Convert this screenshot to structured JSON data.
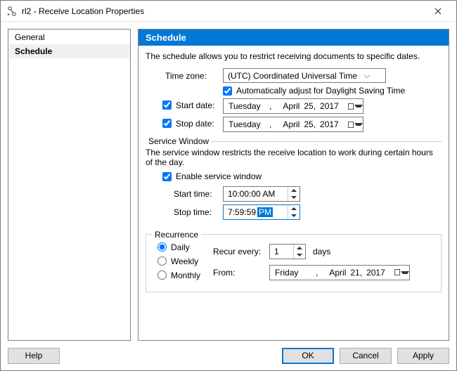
{
  "window": {
    "title": "rl2 - Receive Location Properties"
  },
  "sidebar": {
    "items": [
      {
        "label": "General"
      },
      {
        "label": "Schedule"
      }
    ],
    "selected_index": 1
  },
  "panel": {
    "title": "Schedule",
    "description": "The schedule allows you to restrict receiving documents to specific dates.",
    "timezone": {
      "label": "Time zone:",
      "value": "(UTC) Coordinated Universal Time",
      "auto_dst_label": "Automatically adjust for Daylight Saving Time",
      "auto_dst_checked": true
    },
    "start_date": {
      "label": "Start date:",
      "checked": true,
      "weekday": "Tuesday",
      "month": "April",
      "day": "25,",
      "year": "2017"
    },
    "stop_date": {
      "label": "Stop date:",
      "checked": true,
      "weekday": "Tuesday",
      "month": "April",
      "day": "25,",
      "year": "2017"
    },
    "service_window": {
      "legend": "Service Window",
      "description": "The service window restricts the receive location to work during certain hours of the day.",
      "enable_label": "Enable service window",
      "enable_checked": true,
      "start_label": "Start time:",
      "start_value": "10:00:00 AM",
      "stop_label": "Stop time:",
      "stop_value_time": "7:59:59",
      "stop_value_ampm": "PM"
    },
    "recurrence": {
      "legend": "Recurrence",
      "options": {
        "daily": "Daily",
        "weekly": "Weekly",
        "monthly": "Monthly"
      },
      "selected": "daily",
      "recur_every_label": "Recur every:",
      "recur_every_value": "1",
      "recur_every_unit": "days",
      "from_label": "From:",
      "from_date": {
        "weekday": "Friday",
        "month": "April",
        "day": "21,",
        "year": "2017"
      }
    }
  },
  "buttons": {
    "help": "Help",
    "ok": "OK",
    "cancel": "Cancel",
    "apply": "Apply"
  }
}
